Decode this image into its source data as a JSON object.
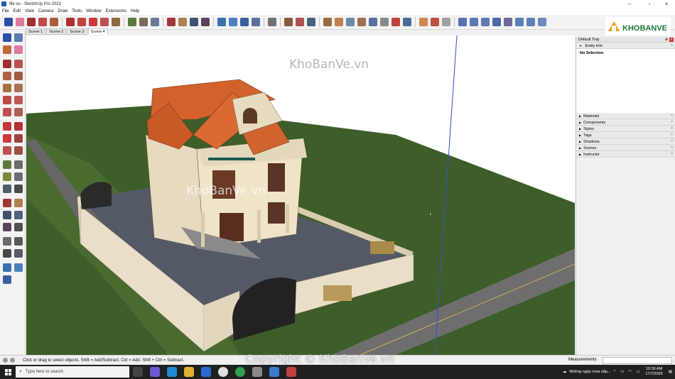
{
  "window": {
    "title": "file su - SketchUp Pro 2021"
  },
  "menu": [
    "File",
    "Edit",
    "View",
    "Camera",
    "Draw",
    "Tools",
    "Window",
    "Extensions",
    "Help"
  ],
  "scenes": {
    "tabs": [
      "Scene 1",
      "Scene 2",
      "Scene 3",
      "Scene 4"
    ],
    "active_index": 3
  },
  "viewport": {
    "watermark": "KhoBanVe.vn",
    "watermark_center": "KhoBanVe.vn"
  },
  "tray": {
    "title": "Default Tray",
    "entity_info": {
      "label": "Entity Info",
      "selection": "No Selection"
    },
    "panels": [
      "Materials",
      "Components",
      "Styles",
      "Tags",
      "Shadows",
      "Scenes",
      "Instructor"
    ]
  },
  "status": {
    "hint": "Click or drag to select objects. Shift = Add/Subtract. Ctrl = Add. Shift + Ctrl = Subtract.",
    "measurements_label": "Measurements",
    "measurements_value": ""
  },
  "taskbar": {
    "search_placeholder": "Type here to search",
    "weather_text": "Những ngày mưa sắp...",
    "time": "10:30 AM",
    "date": "17/7/2025"
  },
  "logo_text": "KHOBANVE",
  "copyright_watermark": "Copyright © KhoBanVe.vn",
  "colors": {
    "sky": "#ffffff",
    "grass": "#3a5a26",
    "road": "#6a6a6a",
    "roof": "#d2622c",
    "wall": "#e8dcc2",
    "paving": "#4f5560",
    "accent_blue": "#3366cc"
  }
}
